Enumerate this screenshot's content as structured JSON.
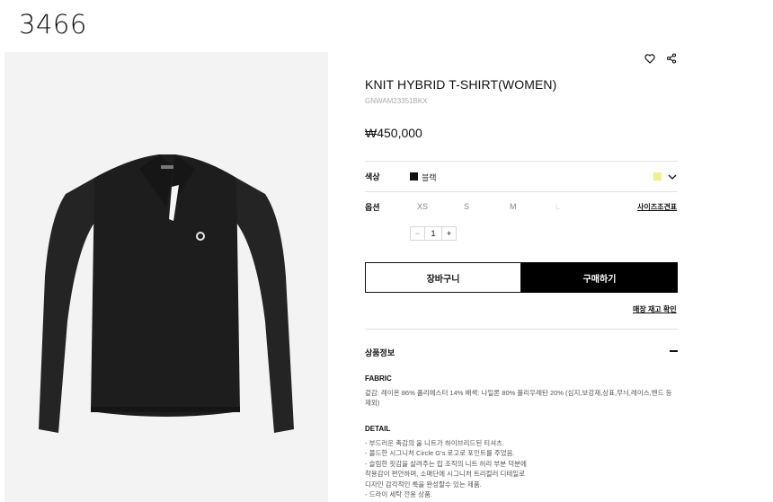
{
  "brand": {
    "logo": "3466"
  },
  "product": {
    "title": "KNIT HYBRID T-SHIRT(WOMEN)",
    "sku": "GNWAM23351BKX",
    "price": "₩450,000"
  },
  "icons": {
    "wishlist": "heart-icon",
    "share": "share-icon",
    "expand": "chevron-down-icon"
  },
  "options": {
    "color_label": "색상",
    "color_name": "블랙",
    "selected_color": "#111111",
    "alt_color": "#eef08a",
    "size_label": "옵션",
    "sizes": [
      "XS",
      "S",
      "M",
      "L"
    ],
    "size_guide": "사이즈조견표",
    "quantity": "1",
    "qty_minus": "−",
    "qty_plus": "+"
  },
  "actions": {
    "cart": "장바구니",
    "buy": "구매하기",
    "stock_check": "매장 재고 확인"
  },
  "info": {
    "section_title": "상품정보",
    "fabric_heading": "FABRIC",
    "fabric_text": "겉감: 레이온 86% 폴리에스터 14% 배색: 나일론 80% 폴리우레탄 20% (심지,보강재,상표,무늬,레이스,밴드 등 제외)",
    "detail_heading": "DETAIL",
    "detail_lines": [
      "- 부드러운 촉감의 울 니트가 하이브리드된 티셔츠.",
      "- 볼드한 시그니처 Circle G's 로고로 포인트를 주었음.",
      "- 슬림한 핏감을 살려주는 립 조직의 니트 허리 부분 덕분에",
      "  착용감이 편안하며, 소매단에 시그니처 트리컬러 디테일로",
      "  디자인 감각적인 룩을 완성할수 있는 제품.",
      "- 드라이 세탁 전용 상품."
    ]
  }
}
